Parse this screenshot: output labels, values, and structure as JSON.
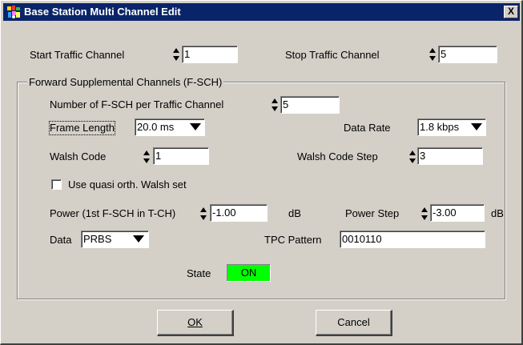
{
  "window": {
    "title": "Base Station Multi Channel Edit",
    "close_symbol": "X"
  },
  "top": {
    "start_label": "Start Traffic Channel",
    "start_value": "1",
    "stop_label": "Stop Traffic Channel",
    "stop_value": "5"
  },
  "group": {
    "legend": "Forward Supplemental Channels (F-SCH)",
    "num_fsch_label": "Number of F-SCH per Traffic Channel",
    "num_fsch_value": "5",
    "frame_length_label": "Frame Length",
    "frame_length_value": "20.0 ms",
    "data_rate_label": "Data Rate",
    "data_rate_value": "1.8 kbps",
    "walsh_code_label": "Walsh Code",
    "walsh_code_value": "1",
    "walsh_step_label": "Walsh Code Step",
    "walsh_step_value": "3",
    "quasi_label": "Use quasi orth. Walsh set",
    "quasi_checked": false,
    "power_label": "Power (1st F-SCH in T-CH)",
    "power_value": "-1.00",
    "power_unit": "dB",
    "power_step_label": "Power Step",
    "power_step_value": "-3.00",
    "power_step_unit": "dB",
    "data_label": "Data",
    "data_value": "PRBS",
    "tpc_label": "TPC Pattern",
    "tpc_value": "0010110",
    "state_label": "State",
    "state_value": "ON"
  },
  "buttons": {
    "ok": "OK",
    "cancel": "Cancel"
  },
  "colors": {
    "title_bg": "#0a246a",
    "dialog_bg": "#d4d0c8",
    "state_on": "#00ff00"
  }
}
